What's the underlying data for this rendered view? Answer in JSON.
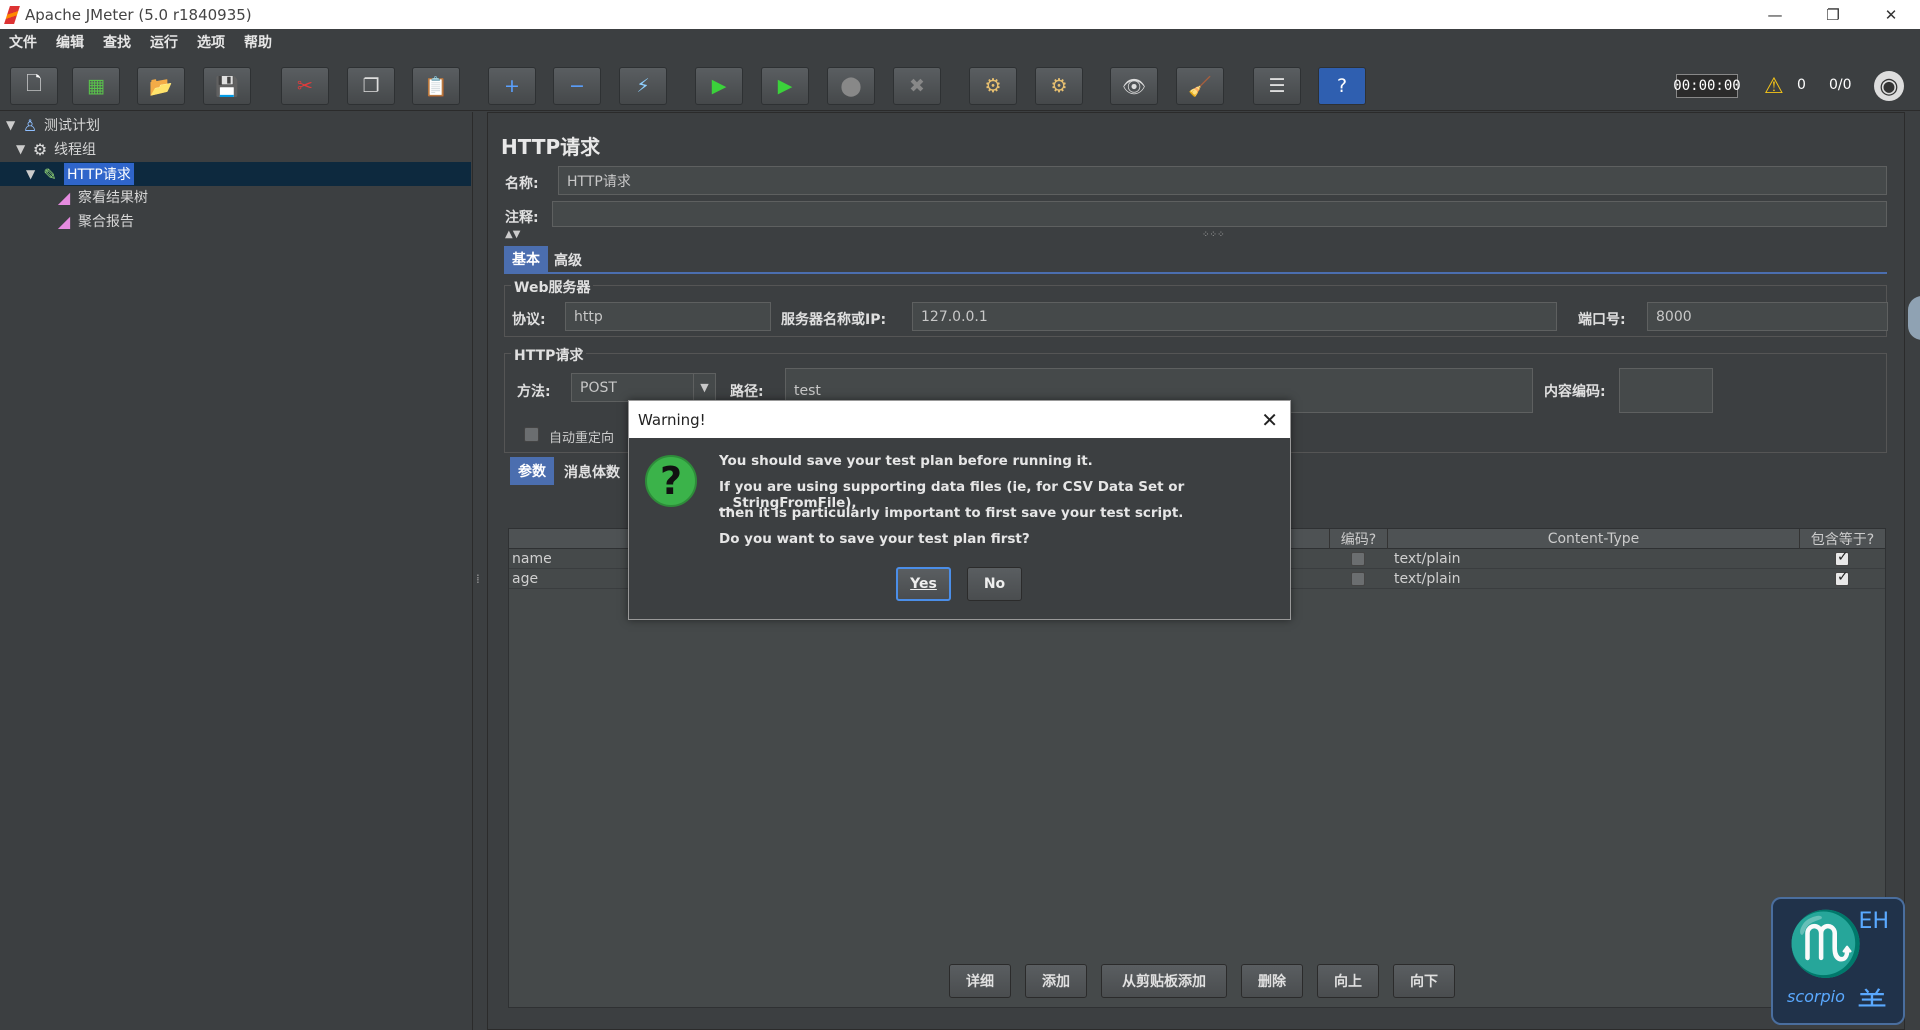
{
  "window": {
    "title": "Apache JMeter (5.0 r1840935)",
    "minimize": "—",
    "maximize": "❐",
    "close": "✕"
  },
  "menu": [
    "文件",
    "编辑",
    "查找",
    "运行",
    "选项",
    "帮助"
  ],
  "toolbar": {
    "icons": [
      {
        "name": "new-icon",
        "glyph": "🗋",
        "color": "#ffffff"
      },
      {
        "name": "templates-icon",
        "glyph": "▦",
        "color": "#59c24b"
      },
      {
        "name": "open-icon",
        "glyph": "📂",
        "color": "#f0b040"
      },
      {
        "name": "save-icon",
        "glyph": "💾",
        "color": "#dddddd"
      },
      {
        "name": "cut-icon",
        "glyph": "✂",
        "color": "#e33b3b"
      },
      {
        "name": "copy-icon",
        "glyph": "❐",
        "color": "#dddddd"
      },
      {
        "name": "paste-icon",
        "glyph": "📋",
        "color": "#f0c060"
      },
      {
        "name": "expand-icon",
        "glyph": "+",
        "color": "#5aa0ff"
      },
      {
        "name": "collapse-icon",
        "glyph": "−",
        "color": "#5aa0ff"
      },
      {
        "name": "toggle-icon",
        "glyph": "⚡",
        "color": "#8fd0ff"
      },
      {
        "name": "start-icon",
        "glyph": "▶",
        "color": "#3bd23b"
      },
      {
        "name": "start-no-pause-icon",
        "glyph": "▶",
        "color": "#3bd23b"
      },
      {
        "name": "stop-icon",
        "glyph": "⬤",
        "color": "#888888"
      },
      {
        "name": "shutdown-icon",
        "glyph": "✖",
        "color": "#888888"
      },
      {
        "name": "clear-icon",
        "glyph": "⚙",
        "color": "#e8c070"
      },
      {
        "name": "clear-all-icon",
        "glyph": "⚙",
        "color": "#e8c070"
      },
      {
        "name": "search-icon",
        "glyph": "👁",
        "color": "#dddddd"
      },
      {
        "name": "reset-search-icon",
        "glyph": "🧹",
        "color": "#f5c518"
      },
      {
        "name": "function-helper-icon",
        "glyph": "☰",
        "color": "#dddddd"
      },
      {
        "name": "help-icon",
        "glyph": "?",
        "color": "#ffffff"
      }
    ],
    "timer": "00:00:00",
    "warning_count": "0",
    "threads": "0/0"
  },
  "tree": [
    {
      "label": "测试计划",
      "icon": "test-plan-icon"
    },
    {
      "label": "线程组",
      "icon": "thread-group-icon"
    },
    {
      "label": "HTTP请求",
      "icon": "sampler-icon"
    },
    {
      "label": "察看结果树",
      "icon": "listener-icon"
    },
    {
      "label": "聚合报告",
      "icon": "listener-icon"
    }
  ],
  "panel": {
    "title": "HTTP请求",
    "name_label": "名称:",
    "name_value": "HTTP请求",
    "comment_label": "注释:",
    "tabs": [
      "基本",
      "高级"
    ],
    "web_server": {
      "title": "Web服务器",
      "protocol_label": "协议:",
      "protocol": "http",
      "server_label": "服务器名称或IP:",
      "server": "127.0.0.1",
      "port_label": "端口号:",
      "port": "8000"
    },
    "http_request": {
      "title": "HTTP请求",
      "method_label": "方法:",
      "method": "POST",
      "path_label": "路径:",
      "path": "test",
      "encoding_label": "内容编码:",
      "redirect_label": "自动重定向"
    },
    "sub_tabs": [
      "参数",
      "消息体数"
    ],
    "table": {
      "headers": [
        "编码?",
        "Content-Type",
        "包含等于?"
      ],
      "rows": [
        {
          "name": "name",
          "encode": false,
          "content_type": "text/plain",
          "include_equals": true
        },
        {
          "name": "age",
          "encode": false,
          "content_type": "text/plain",
          "include_equals": true
        }
      ]
    },
    "buttons": [
      "详细",
      "添加",
      "从剪贴板添加",
      "删除",
      "向上",
      "向下"
    ]
  },
  "dialog": {
    "title": "Warning!",
    "lines": [
      "You should save your test plan before running it.",
      "If you are using supporting data files (ie, for CSV Data Set or __StringFromFile),",
      "then it is particularly important to first save your test script.",
      "Do you want to save your test plan first?"
    ],
    "yes": "Yes",
    "no": "No"
  },
  "watermark": {
    "sub": "scorpio"
  }
}
